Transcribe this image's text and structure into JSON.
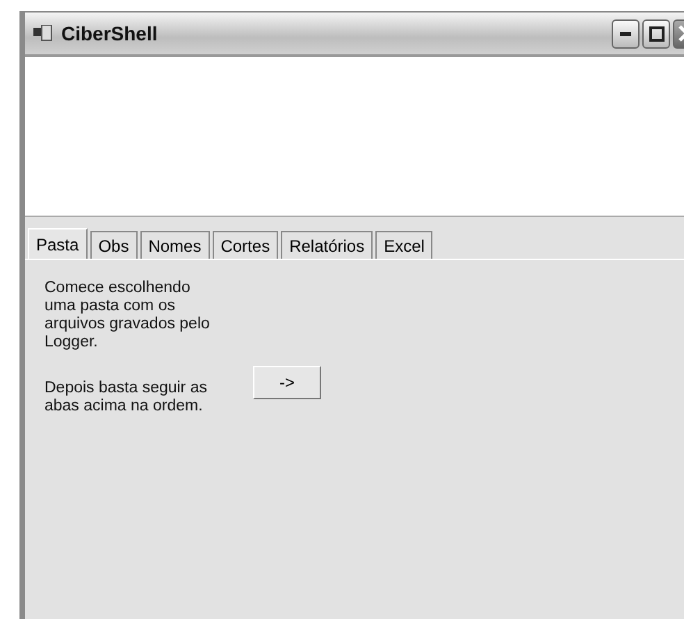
{
  "window": {
    "title": "CiberShell"
  },
  "tabs": [
    {
      "label": "Pasta",
      "selected": true
    },
    {
      "label": "Obs",
      "selected": false
    },
    {
      "label": "Nomes",
      "selected": false
    },
    {
      "label": "Cortes",
      "selected": false
    },
    {
      "label": "Relatórios",
      "selected": false
    },
    {
      "label": "Excel",
      "selected": false
    }
  ],
  "panel": {
    "paragraphs": [
      "Comece escolhendo uma pasta com os arquivos gravados pelo Logger.",
      "Depois basta seguir as abas acima na ordem."
    ],
    "button": "->"
  }
}
